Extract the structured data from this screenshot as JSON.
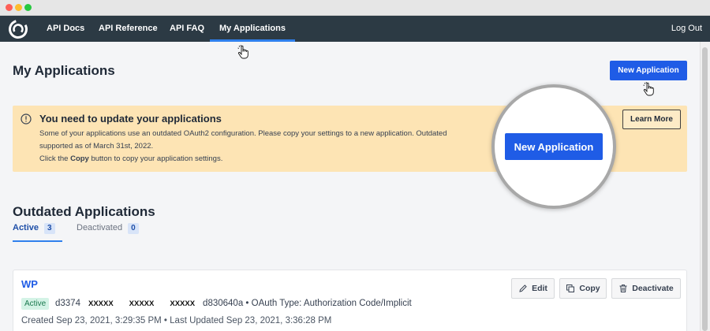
{
  "nav": {
    "links": [
      "API Docs",
      "API Reference",
      "API FAQ",
      "My Applications"
    ],
    "logout": "Log Out"
  },
  "page": {
    "title": "My Applications",
    "new_app_button": "New Application"
  },
  "alert": {
    "title": "You need to update your applications",
    "line1": "Some of your applications use an outdated OAuth2 configuration. Please copy your settings to a new application. Outdated",
    "line2": "supported as of March 31st, 2022.",
    "line3_prefix": "Click the",
    "line3_bold": "Copy",
    "line3_suffix": "button to copy your application settings.",
    "learn_more": "Learn More"
  },
  "magnifier": {
    "button": "New Application"
  },
  "outdated": {
    "title": "Outdated Applications",
    "tabs": [
      {
        "label": "Active",
        "count": "3"
      },
      {
        "label": "Deactivated",
        "count": "0"
      }
    ]
  },
  "app": {
    "name": "WP",
    "status": "Active",
    "id_start": "d3374",
    "redact1": "XXXXX",
    "redact2": "XXXXX",
    "redact3": "XXXXX",
    "id_end": "d830640a",
    "oauth_type": "• OAuth Type: Authorization Code/Implicit",
    "created": "Created Sep 23, 2021, 3:29:35 PM • Last Updated Sep 23, 2021, 3:36:28 PM",
    "edit": "Edit",
    "copy": "Copy",
    "deactivate": "Deactivate"
  },
  "colors": {
    "navbar": "#2c3a44",
    "accent": "#1f5ce6",
    "alert_bg": "#fde4b4",
    "active_badge": "#d4f3e6"
  },
  "icons": [
    "logo-icon",
    "pointer-cursor-icon",
    "info-icon",
    "edit-icon",
    "copy-icon",
    "trash-icon"
  ]
}
